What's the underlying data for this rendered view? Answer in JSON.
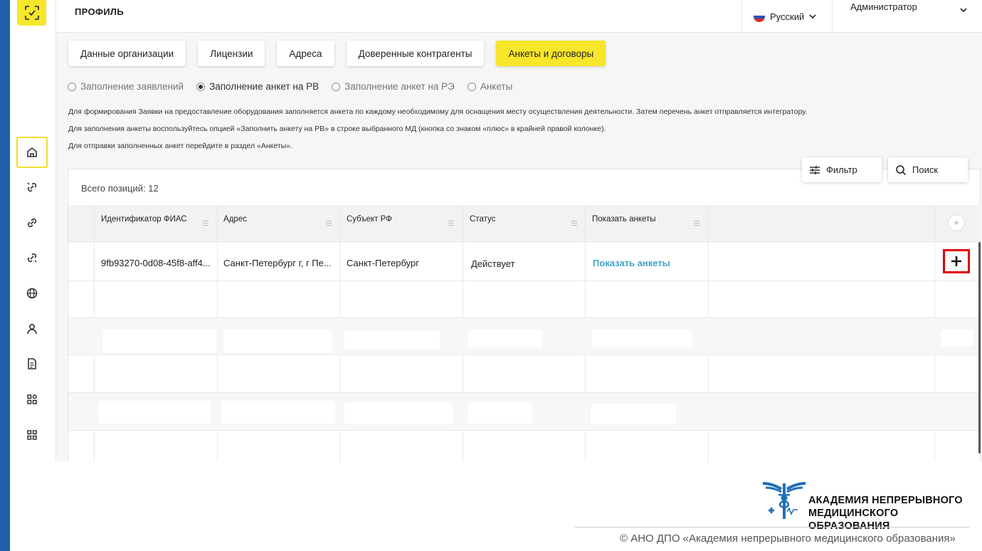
{
  "header": {
    "title": "ПРОФИЛЬ",
    "language": "Русский",
    "user": "Администратор"
  },
  "tabs": [
    {
      "label": "Данные организации",
      "active": false
    },
    {
      "label": "Лицензии",
      "active": false
    },
    {
      "label": "Адреса",
      "active": false
    },
    {
      "label": "Доверенные контрагенты",
      "active": false
    },
    {
      "label": "Анкеты и договоры",
      "active": true
    }
  ],
  "radios": [
    {
      "label": "Заполнение заявлений",
      "selected": false
    },
    {
      "label": "Заполнение анкет на РВ",
      "selected": true
    },
    {
      "label": "Заполнение анкет на РЭ",
      "selected": false
    },
    {
      "label": "Анкеты",
      "selected": false
    }
  ],
  "info": [
    "Для формирования Заявки на предоставление оборудования заполняется анкета по каждому необходимому для оснащения месту осуществления деятельности. Затем перечень анкет отправляется интегратору.",
    "Для заполнения анкеты воспользуйтесь опцией «Заполнить анкету на РВ» в строке выбранного МД (кнопка со знаком «плюс» в крайней правой колонке).",
    "Для отправки заполненных анкет перейдите в раздел «Анкеты»."
  ],
  "toolbar": {
    "filter_label": "Фильтр",
    "search_label": "Поиск"
  },
  "table": {
    "total": "Всего позиций: 12",
    "columns": [
      "Идентификатор ФИАС",
      "Адрес",
      "Субъект РФ",
      "Статус",
      "Показать анкеты"
    ],
    "rows": [
      {
        "fias": "9fb93270-0d08-45f8-aff4...",
        "address": "Санкт-Петербург г, г Пе...",
        "subject": "Санкт-Петербург",
        "status": "Действует",
        "link": "Показать анкеты"
      }
    ]
  },
  "footer": {
    "academy_line1": "АКАДЕМИЯ НЕПРЕРЫВНОГО",
    "academy_line2": "МЕДИЦИНСКОГО ОБРАЗОВАНИЯ",
    "copyright": "© АНО ДПО «Академия непрерывного медицинского образования»"
  },
  "colors": {
    "accent": "#f7e62a",
    "link": "#43a3c9",
    "highlight": "#dd0000",
    "sidebar_strip": "#1f5fae"
  }
}
